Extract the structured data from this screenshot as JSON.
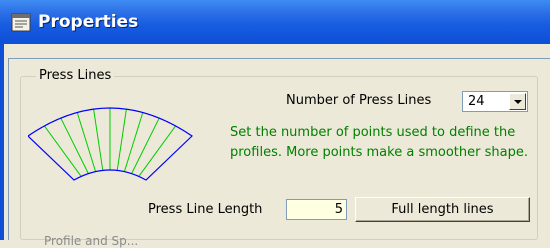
{
  "window": {
    "title": "Properties",
    "icon": "properties-window-icon"
  },
  "group": {
    "legend": "Press Lines"
  },
  "number_of_press_lines": {
    "label": "Number of Press Lines",
    "value": "24"
  },
  "hint_text": "Set the number of points used to define the profiles. More points make a smoother shape.",
  "press_line_length": {
    "label": "Press Line Length",
    "value": "5"
  },
  "full_length_button": {
    "label": "Full length lines"
  },
  "next_group_fragment": "Profile and Sp...",
  "colors": {
    "titlebar": "#165be0",
    "title_text": "#ffffff",
    "hint_text": "#008000",
    "fan_outline": "#0000ff",
    "fan_lines": "#00cc00",
    "length_field_bg": "#ffffe1",
    "dialog_bg": "#ece9d8"
  }
}
